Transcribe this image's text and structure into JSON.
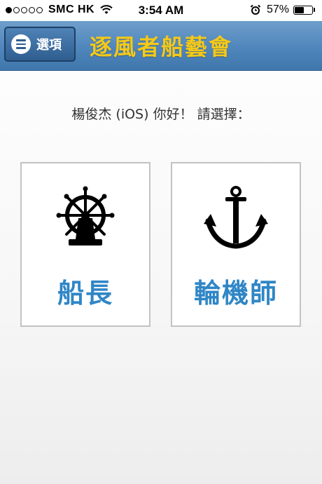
{
  "status_bar": {
    "carrier": "SMC HK",
    "time": "3:54 AM",
    "battery_percent": "57%",
    "battery_level": 0.57,
    "signal_bars_filled": 1,
    "signal_bars_total": 5,
    "icons": [
      "wifi-icon",
      "alarm-icon",
      "battery-icon"
    ]
  },
  "header": {
    "menu_label": "選項",
    "title": "逐風者船藝會",
    "background_color": "#4f86bb",
    "title_color": "#f5c918"
  },
  "main": {
    "greeting": "楊俊杰 (iOS) 你好！ 請選擇：",
    "roles": [
      {
        "label": "船長",
        "icon": "ship-wheel-icon"
      },
      {
        "label": "輪機師",
        "icon": "anchor-icon"
      }
    ],
    "label_color": "#2f86c6"
  }
}
